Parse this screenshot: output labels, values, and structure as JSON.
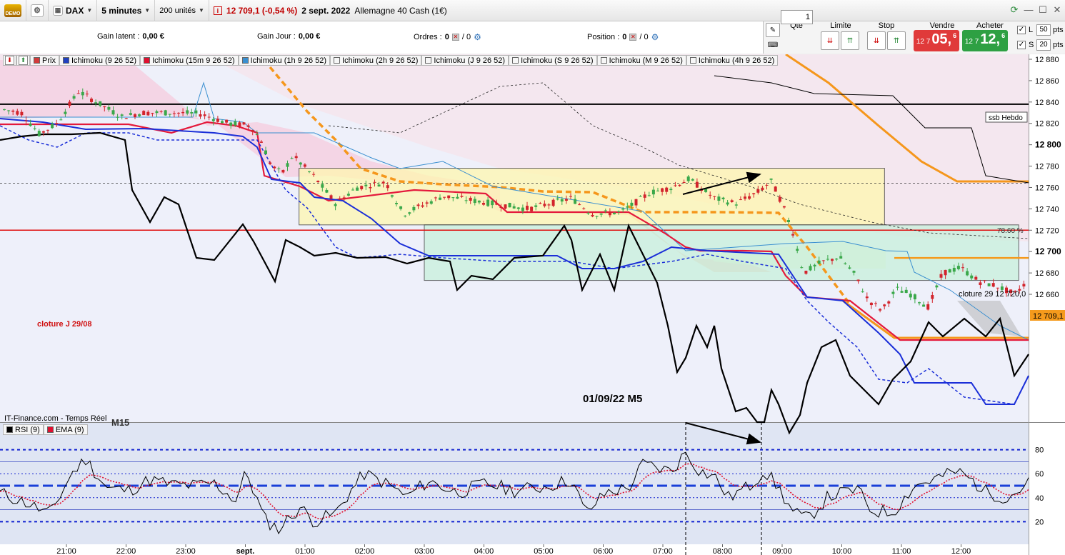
{
  "toolbar": {
    "demo_label": "DEMO",
    "instrument": "DAX",
    "timeframe": "5 minutes",
    "units": "200 unités",
    "price_change": "12 709,1 (-0,54 %)",
    "date": "2 sept. 2022",
    "instrument_name": "Allemagne 40 Cash (1€)"
  },
  "account": {
    "gain_latent_label": "Gain latent :",
    "gain_latent_value": "0,00 €",
    "gain_jour_label": "Gain Jour :",
    "gain_jour_value": "0,00 €",
    "ordres_label": "Ordres :",
    "ordres_value": "0",
    "ordres_total": "/ 0",
    "position_label": "Position :",
    "position_value": "0",
    "position_total": "/ 0"
  },
  "order_panel": {
    "qty_label": "Qté",
    "qty_value": "1",
    "limit_label": "Limite",
    "stop_label": "Stop",
    "sell_label": "Vendre",
    "sell_prefix": "12 7",
    "sell_big": "05,",
    "sell_sup": "6",
    "buy_label": "Acheter",
    "buy_prefix": "12 7",
    "buy_big": "12,",
    "buy_sup": "6",
    "l_label": "L",
    "l_value": "50",
    "s_label": "S",
    "s_value": "20",
    "pts_label": "pts",
    "sell_color": "#e03a3a",
    "buy_color": "#2ea043"
  },
  "legend": [
    {
      "label": "Prix",
      "color": "#d23b3b"
    },
    {
      "label": "Ichimoku (9 26 52)",
      "color": "#2040c0"
    },
    {
      "label": "Ichimoku (15m 9 26 52)",
      "color": "#e01030"
    },
    {
      "label": "Ichimoku (1h 9 26 52)",
      "color": "#3a8fd0"
    },
    {
      "label": "Ichimoku (2h 9 26 52)",
      "color": "#ffffff"
    },
    {
      "label": "Ichimoku (J 9 26 52)",
      "color": "#ffffff"
    },
    {
      "label": "Ichimoku (S 9 26 52)",
      "color": "#ffffff"
    },
    {
      "label": "Ichimoku (M 9 26 52)",
      "color": "#ffffff"
    },
    {
      "label": "Ichimoku (4h 9 26 52)",
      "color": "#ffffff"
    }
  ],
  "rsi_legend": [
    {
      "label": "RSI (9)",
      "color": "#000000"
    },
    {
      "label": "EMA (9)",
      "color": "#e01030"
    }
  ],
  "chart_data": {
    "type": "candlestick",
    "instrument": "DAX",
    "timeframe": "5 minutes",
    "x_ticks": [
      "21:00",
      "22:00",
      "23:00",
      "sept.",
      "01:00",
      "02:00",
      "03:00",
      "04:00",
      "05:00",
      "06:00",
      "07:00",
      "08:00",
      "09:00",
      "10:00",
      "11:00",
      "12:00"
    ],
    "y_ticks": [
      12880,
      12860,
      12840,
      12820,
      12800,
      12780,
      12760,
      12740,
      12720,
      12700,
      12680,
      12660
    ],
    "y_bold_ticks": [
      12800,
      12700
    ],
    "ylim": [
      12646,
      12885
    ],
    "last_price": "12 709,1",
    "annotations": {
      "ssb_hebdo": "ssb Hebdo",
      "ssb_hebdo_level": 12838,
      "fib_label": "78.60 %",
      "fib_level": 12764,
      "cloture_29_label": "cloture 29 12 720,0",
      "cloture_j_label": "cloture J  29/08",
      "cloture_level": 12720,
      "session_label": "01/09/22   M5",
      "watermark": "IT-Finance.com - Temps Réel",
      "watermark_tf": "M15"
    },
    "zones": [
      {
        "name": "range-box",
        "from_time": "00:54",
        "to_time": "10:43",
        "low": 12725,
        "high": 12778,
        "color": "#fff7b0"
      },
      {
        "name": "support-box",
        "from_time": "03:00",
        "to_time": "12:58",
        "low": 12673,
        "high": 12725,
        "color": "#c8f0dc"
      }
    ],
    "key_levels": [
      {
        "name": "ssb-hebdo",
        "value": 12838,
        "color": "#000000"
      },
      {
        "name": "cloture",
        "value": 12720,
        "color": "#e01010"
      },
      {
        "name": "orange-level",
        "value": 12694,
        "color": "#f59a1c"
      }
    ],
    "rsi": {
      "y_ticks": [
        80,
        60,
        40,
        20
      ],
      "ylim": [
        0,
        100
      ],
      "overbought": 80,
      "oversold": 20,
      "mid": 50,
      "bands": [
        30,
        70
      ]
    }
  }
}
